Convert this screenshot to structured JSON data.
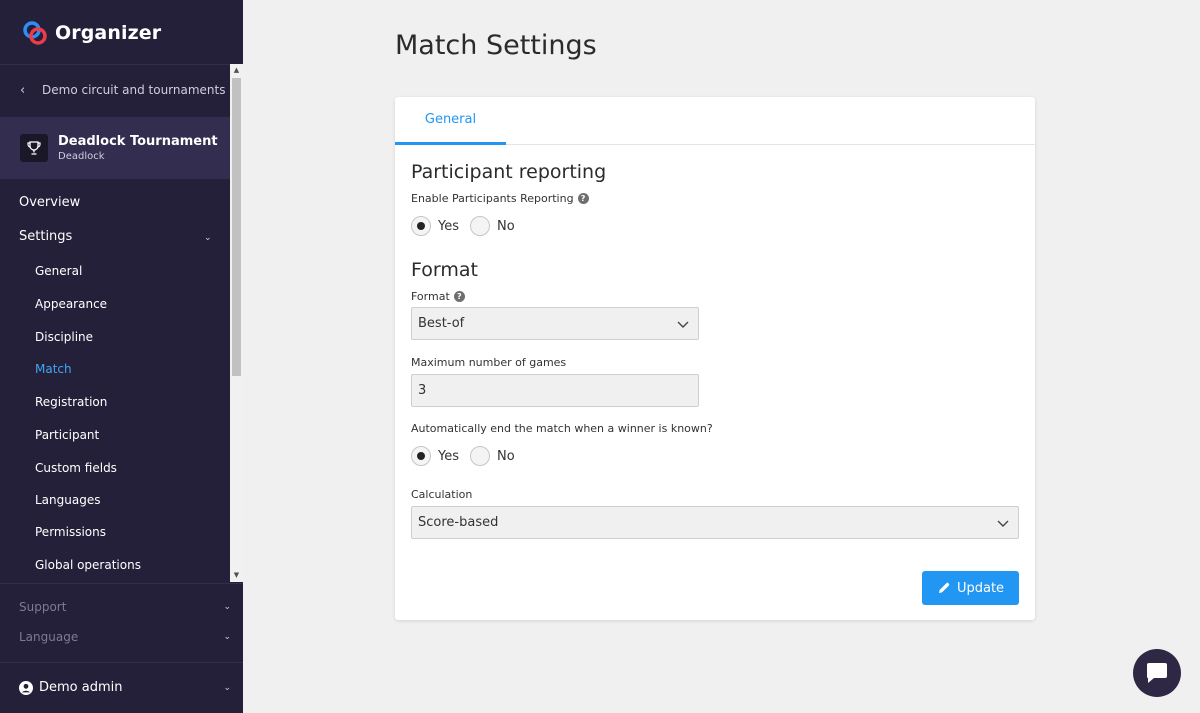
{
  "app": {
    "name": "Organizer"
  },
  "sidebar": {
    "back_link": "Demo circuit and tournaments",
    "tournament": {
      "name": "Deadlock Tournament",
      "discipline": "Deadlock"
    },
    "nav": {
      "overview": "Overview",
      "settings": "Settings"
    },
    "settings_items": [
      {
        "label": "General",
        "active": false
      },
      {
        "label": "Appearance",
        "active": false
      },
      {
        "label": "Discipline",
        "active": false
      },
      {
        "label": "Match",
        "active": true
      },
      {
        "label": "Registration",
        "active": false
      },
      {
        "label": "Participant",
        "active": false
      },
      {
        "label": "Custom fields",
        "active": false
      },
      {
        "label": "Languages",
        "active": false
      },
      {
        "label": "Permissions",
        "active": false
      },
      {
        "label": "Global operations",
        "active": false
      }
    ],
    "footer": {
      "support": "Support",
      "language": "Language"
    },
    "user": {
      "name": "Demo admin"
    }
  },
  "page": {
    "title": "Match Settings"
  },
  "tabs": [
    {
      "label": "General",
      "active": true
    }
  ],
  "participant_reporting": {
    "title": "Participant reporting",
    "label": "Enable Participants Reporting",
    "options": {
      "yes": "Yes",
      "no": "No"
    },
    "selected": "Yes"
  },
  "format_section": {
    "title": "Format",
    "format_label": "Format",
    "format_value": "Best-of",
    "max_games_label": "Maximum number of games",
    "max_games_value": "3",
    "auto_end_label": "Automatically end the match when a winner is known?",
    "auto_end_options": {
      "yes": "Yes",
      "no": "No"
    },
    "auto_end_selected": "Yes",
    "calculation_label": "Calculation",
    "calculation_value": "Score-based"
  },
  "actions": {
    "update": "Update"
  },
  "colors": {
    "sidebar_bg": "#24203a",
    "accent": "#2196f3",
    "active_nav": "#42a5f5"
  },
  "icons": [
    "logo-icon",
    "chevron-left-icon",
    "trophy-icon",
    "chevron-down-icon",
    "help-icon",
    "user-icon",
    "pencil-icon",
    "chat-icon"
  ]
}
